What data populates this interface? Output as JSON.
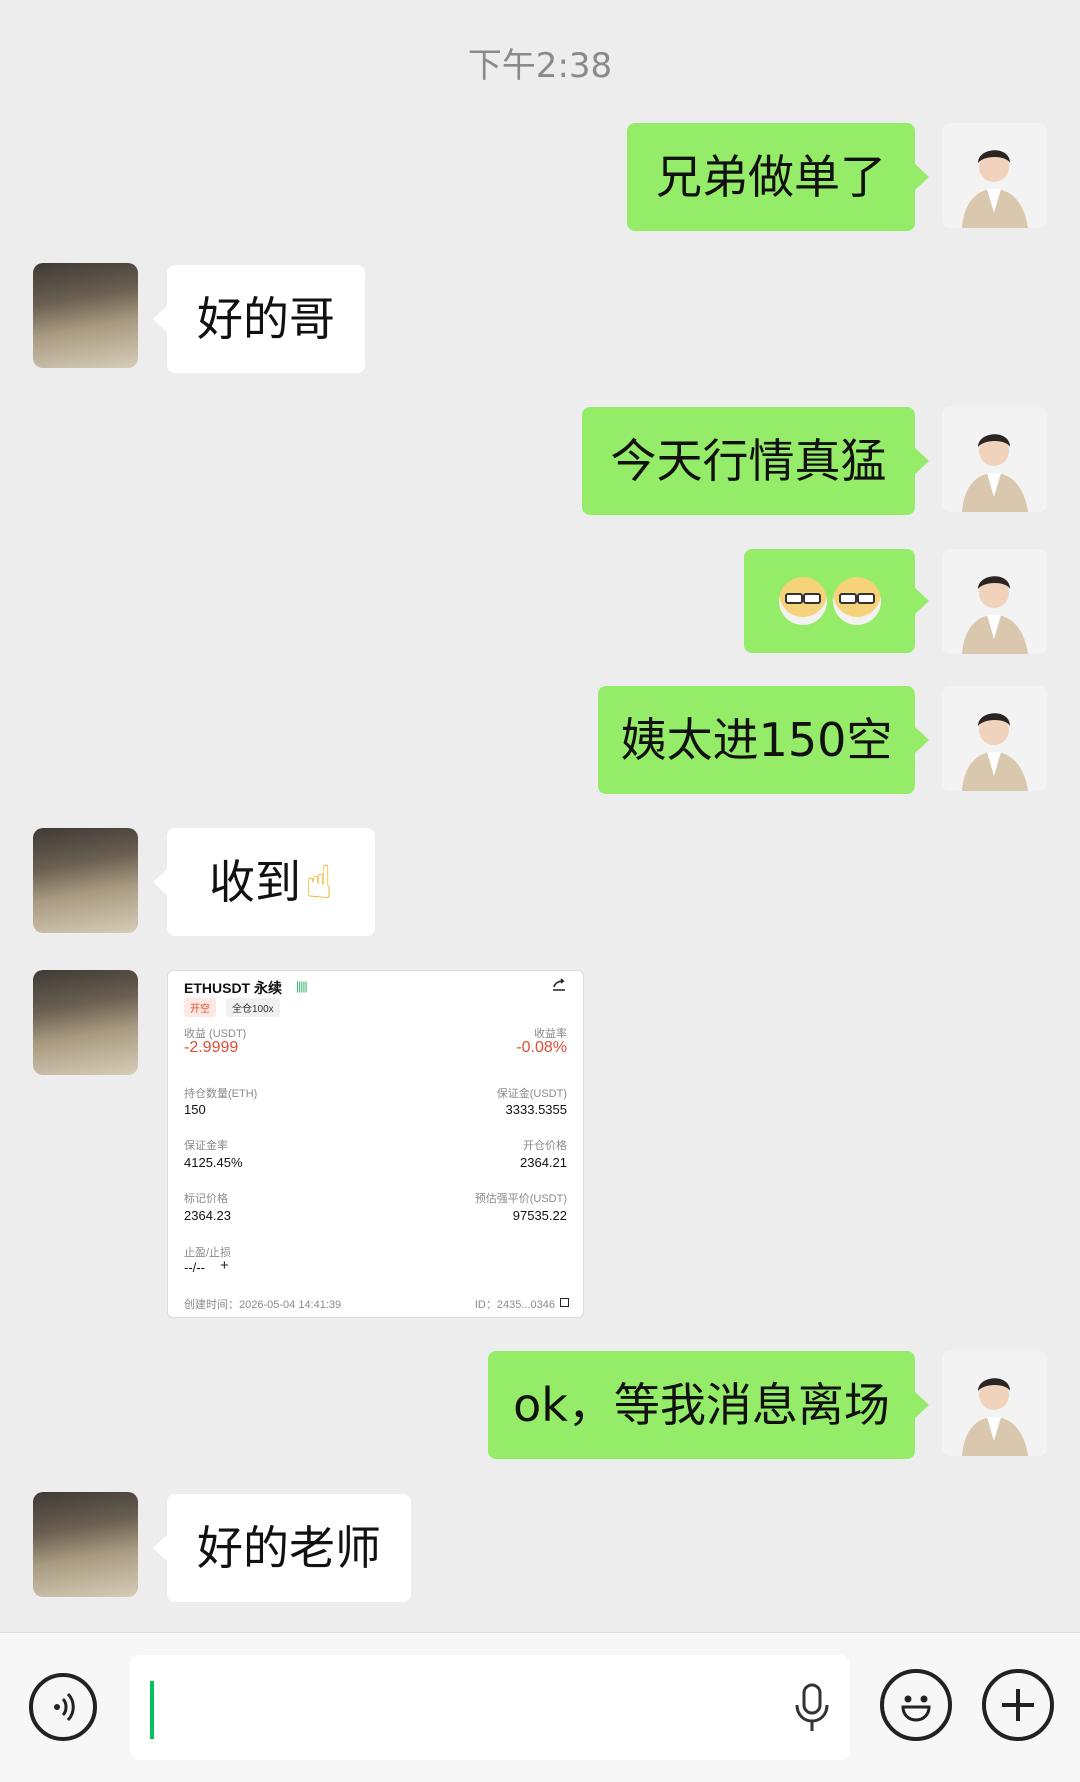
{
  "timestamp": "下午2:38",
  "messages": [
    {
      "text": "兄弟做单了"
    },
    {
      "text": "好的哥"
    },
    {
      "text": "今天行情真猛"
    },
    {
      "text": "姨太进150空"
    },
    {
      "text": "收到"
    },
    {
      "text": "ok，等我消息离场"
    },
    {
      "text": "好的老师"
    }
  ],
  "emoji_names": [
    "dog-face-emoji",
    "ok-hand-emoji"
  ],
  "trade_card": {
    "symbol": "ETHUSDT 永续",
    "tag_open": "开空",
    "tag_margin": "全仓100x",
    "pnl_label": "收益 (USDT)",
    "pnl_value": "-2.9999",
    "roe_label": "收益率",
    "roe_value": "-0.08%",
    "size_label": "持仓数量(ETH)",
    "size_value": "150",
    "margin_label": "保证金(USDT)",
    "margin_value": "3333.5355",
    "margin_rate_label": "保证金率",
    "margin_rate_value": "4125.45%",
    "entry_label": "开仓价格",
    "entry_value": "2364.21",
    "mark_label": "标记价格",
    "mark_value": "2364.23",
    "liq_label": "预估强平价(USDT)",
    "liq_value": "97535.22",
    "tpsl_label": "止盈/止损",
    "tpsl_value": "--/--",
    "created": "创建时间：2026-05-04 14:41:39",
    "id": "ID：2435...0346"
  },
  "colors": {
    "background": "#ededed",
    "outgoing_bubble": "#95ec69",
    "incoming_bubble": "#ffffff",
    "loss_red": "#e04b33",
    "caret_green": "#07c160"
  },
  "icons": [
    "voice-icon",
    "microphone-icon",
    "emoji-icon",
    "plus-icon",
    "share-icon"
  ]
}
